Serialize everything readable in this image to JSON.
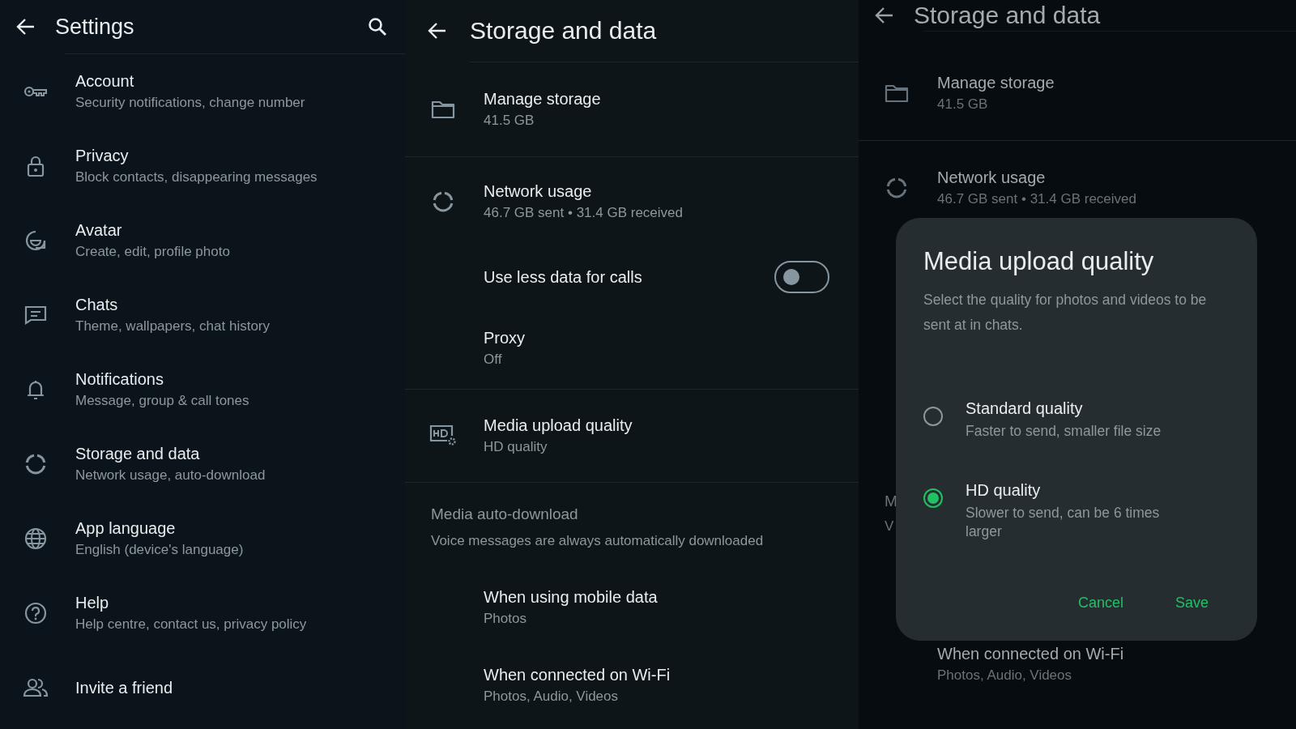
{
  "settings_screen": {
    "title": "Settings",
    "items": [
      {
        "title": "Account",
        "subtitle": "Security notifications, change number"
      },
      {
        "title": "Privacy",
        "subtitle": "Block contacts, disappearing messages"
      },
      {
        "title": "Avatar",
        "subtitle": "Create, edit, profile photo"
      },
      {
        "title": "Chats",
        "subtitle": "Theme, wallpapers, chat history"
      },
      {
        "title": "Notifications",
        "subtitle": "Message, group & call tones"
      },
      {
        "title": "Storage and data",
        "subtitle": "Network usage, auto-download"
      },
      {
        "title": "App language",
        "subtitle": "English (device's language)"
      },
      {
        "title": "Help",
        "subtitle": "Help centre, contact us, privacy policy"
      },
      {
        "title": "Invite a friend"
      }
    ]
  },
  "storage_screen": {
    "title": "Storage and data",
    "items": [
      {
        "kind": "item",
        "title": "Manage storage",
        "subtitle": "41.5 GB"
      },
      {
        "kind": "item",
        "title": "Network usage",
        "subtitle": "46.7 GB sent • 31.4 GB received"
      },
      {
        "kind": "toggle",
        "title": "Use less data for calls",
        "on": false
      },
      {
        "kind": "item",
        "title": "Proxy",
        "subtitle": "Off"
      },
      {
        "kind": "item",
        "title": "Media upload quality",
        "subtitle": "HD quality"
      },
      {
        "kind": "header",
        "title": "Media auto-download",
        "subtitle": "Voice messages are always automatically downloaded"
      },
      {
        "kind": "item",
        "title": "When using mobile data",
        "subtitle": "Photos"
      },
      {
        "kind": "item",
        "title": "When connected on Wi-Fi",
        "subtitle": "Photos, Audio, Videos"
      }
    ]
  },
  "dialog_screen": {
    "title": "Storage and data",
    "items": [
      {
        "title": "Manage storage",
        "subtitle": "41.5 GB"
      },
      {
        "title": "Network usage",
        "subtitle": "46.7 GB sent • 31.4 GB received"
      }
    ],
    "hidden_fragments": [
      "M",
      "V"
    ],
    "bottom_item": {
      "title": "When connected on Wi-Fi",
      "subtitle": "Photos, Audio, Videos"
    },
    "dialog": {
      "title": "Media upload quality",
      "description": "Select the quality for photos and videos to be sent at in chats.",
      "options": [
        {
          "label": "Standard quality",
          "detail": "Faster to send, smaller file size",
          "selected": false
        },
        {
          "label": "HD quality",
          "detail": "Slower to send, can be 6 times larger",
          "selected": true
        }
      ],
      "buttons": [
        "Cancel",
        "Save"
      ]
    }
  }
}
